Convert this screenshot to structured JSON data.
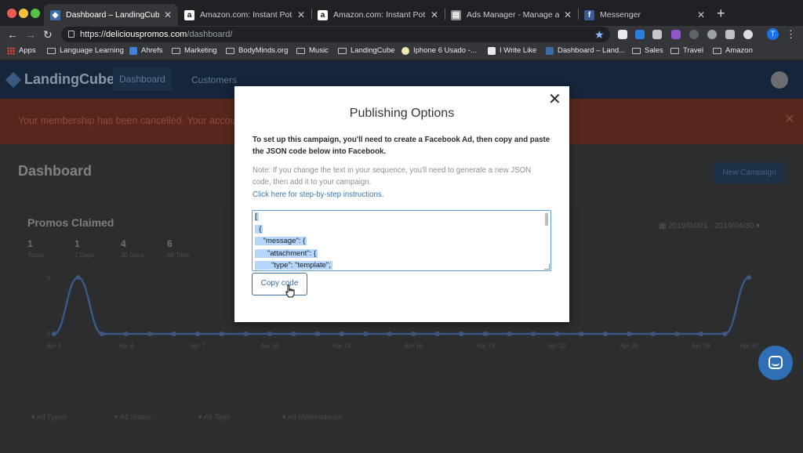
{
  "browser": {
    "tabs": [
      {
        "title": "Dashboard – LandingCube",
        "active": true
      },
      {
        "title": "Amazon.com: Instant Pot Duo",
        "active": false
      },
      {
        "title": "Amazon.com: Instant Pot Duo",
        "active": false
      },
      {
        "title": "Ads Manager - Manage ads - ",
        "active": false
      },
      {
        "title": "Messenger",
        "active": false
      }
    ],
    "url": {
      "scheme": "https://",
      "host": "deliciouspromos.com",
      "path": "/dashboard/"
    },
    "profile_initial": "T",
    "bookmarks": [
      "Apps",
      "Language Learning",
      "Ahrefs",
      "Marketing",
      "BodyMinds.org",
      "Music",
      "LandingCube",
      "Iphone 6 Usado -...",
      "I Write Like",
      "Dashboard – Land...",
      "Sales",
      "Travel",
      "Amazon"
    ]
  },
  "app": {
    "logo": "LandingCube",
    "nav": {
      "dashboard": "Dashboard",
      "customers": "Customers"
    },
    "banner": "Your membership has been cancelled. Your accou",
    "page_title": "Dashboard",
    "new_campaign": "New Campaign",
    "promos_title": "Promos Claimed",
    "stats": [
      {
        "value": "1",
        "label": "Today"
      },
      {
        "value": "1",
        "label": "7 Days"
      },
      {
        "value": "4",
        "label": "30 Days"
      },
      {
        "value": "6",
        "label": "All Time"
      }
    ],
    "date_range": "2019/04/01 - 2019/04/30",
    "filters": [
      "All Types",
      "All Status",
      "All Tags",
      "All Marketplaces"
    ]
  },
  "chart_data": {
    "type": "line",
    "x": [
      "Apr 1",
      "Apr 2",
      "Apr 3",
      "Apr 4",
      "Apr 5",
      "Apr 6",
      "Apr 7",
      "Apr 8",
      "Apr 9",
      "Apr 10",
      "Apr 11",
      "Apr 12",
      "Apr 13",
      "Apr 14",
      "Apr 15",
      "Apr 16",
      "Apr 17",
      "Apr 18",
      "Apr 19",
      "Apr 20",
      "Apr 21",
      "Apr 22",
      "Apr 23",
      "Apr 24",
      "Apr 25",
      "Apr 26",
      "Apr 27",
      "Apr 28",
      "Apr 29",
      "Apr 30"
    ],
    "y": [
      0,
      1,
      0,
      0,
      0,
      0,
      0,
      0,
      0,
      0,
      0,
      0,
      0,
      0,
      0,
      0,
      0,
      0,
      0,
      0,
      0,
      0,
      0,
      0,
      0,
      0,
      0,
      0,
      0,
      1
    ],
    "x_tick_labels": [
      "Apr 1",
      "Apr 4",
      "Apr 7",
      "Apr 10",
      "Apr 13",
      "Apr 16",
      "Apr 19",
      "Apr 22",
      "Apr 25",
      "Apr 28",
      "Apr 30"
    ],
    "y_tick_labels": [
      "0",
      "1"
    ],
    "ylim": [
      0,
      1
    ],
    "colors": {
      "line": "#3a5a84"
    }
  },
  "modal": {
    "title": "Publishing Options",
    "instructions": "To set up this campaign, you'll need to create a Facebook Ad, then copy and paste the JSON code below into Facebook.",
    "note": "Note: If you change the text in your sequence, you'll need to generate a new JSON code, then add it to your campaign.",
    "link": "Click here for step-by-step instructions.",
    "json_lines": [
      "[",
      "  {",
      "    \"message\": {",
      "      \"attachment\": {",
      "        \"type\": \"template\","
    ],
    "copy_button": "Copy code",
    "close_symbol": "✕"
  }
}
